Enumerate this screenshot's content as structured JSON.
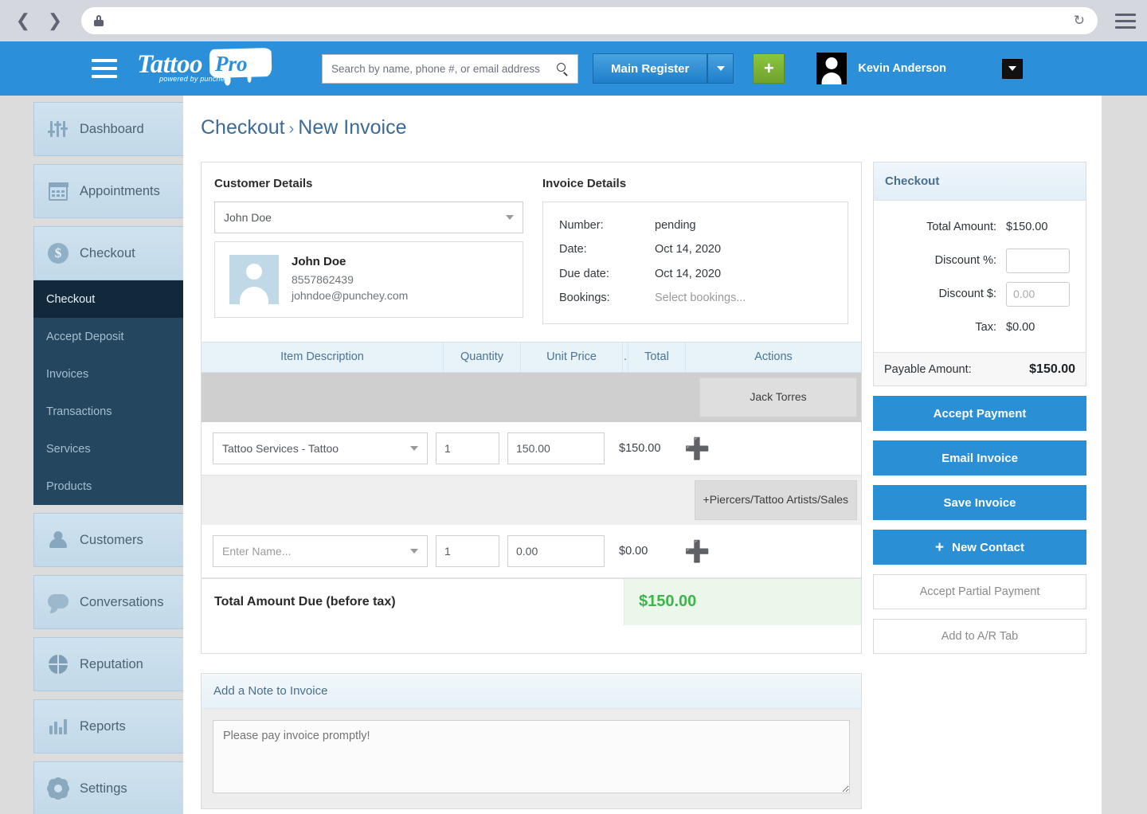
{
  "browser": {
    "back_icon": "back-arrow-icon",
    "forward_icon": "forward-arrow-icon",
    "url_value": "",
    "lock_icon": "lock-icon",
    "reload_icon": "reload-icon",
    "menu_icon": "browser-menu-icon"
  },
  "appbar": {
    "menu_icon": "hamburger-menu-icon",
    "logo": {
      "word1": "Tattoo",
      "word2": "Pro",
      "tagline": "powered by punchey"
    },
    "search": {
      "placeholder": "Search by name, phone #, or email address",
      "value": "",
      "icon": "search-icon"
    },
    "register_label": "Main Register",
    "register_caret_icon": "chevron-down-icon",
    "add_label": "+",
    "user_name": "Kevin Anderson",
    "user_caret_icon": "chevron-down-icon"
  },
  "sidebar": {
    "items": [
      {
        "label": "Dashboard",
        "icon": "sliders-icon"
      },
      {
        "label": "Appointments",
        "icon": "calendar-icon"
      },
      {
        "label": "Checkout",
        "icon": "dollar-circle-icon"
      }
    ],
    "submenu": [
      {
        "label": "Checkout",
        "active": true
      },
      {
        "label": "Accept Deposit",
        "active": false
      },
      {
        "label": "Invoices",
        "active": false
      },
      {
        "label": "Transactions",
        "active": false
      },
      {
        "label": "Services",
        "active": false
      },
      {
        "label": "Products",
        "active": false
      }
    ],
    "items_after": [
      {
        "label": "Customers",
        "icon": "person-icon"
      },
      {
        "label": "Conversations",
        "icon": "chat-bubble-icon"
      },
      {
        "label": "Reputation",
        "icon": "globe-icon"
      },
      {
        "label": "Reports",
        "icon": "bar-chart-icon"
      },
      {
        "label": "Settings",
        "icon": "gear-icon"
      }
    ]
  },
  "breadcrumb": {
    "parent": "Checkout",
    "separator": "›",
    "current": "New Invoice"
  },
  "customer": {
    "section_title": "Customer Details",
    "select_value": "John Doe",
    "name": "John Doe",
    "phone": "8557862439",
    "email": "johndoe@punchey.com"
  },
  "invoice": {
    "section_title": "Invoice Details",
    "rows": [
      {
        "key": "Number:",
        "value": "pending",
        "muted": false
      },
      {
        "key": "Date:",
        "value": "Oct 14, 2020",
        "muted": false
      },
      {
        "key": "Due date:",
        "value": "Oct 14, 2020",
        "muted": false
      },
      {
        "key": "Bookings:",
        "value": "Select bookings...",
        "muted": true
      }
    ]
  },
  "items_table": {
    "headers": {
      "description": "Item Description",
      "quantity": "Quantity",
      "unit_price": "Unit Price",
      "dot": ".",
      "total": "Total",
      "actions": "Actions"
    },
    "groups": [
      {
        "chip_label": "Jack Torres",
        "row": {
          "description": "Tattoo Services - Tattoo",
          "quantity": "1",
          "unit_price": "150.00",
          "total": "$150.00",
          "add_icon": "add-plus-icon"
        }
      },
      {
        "chip_label": "+Piercers/Tattoo Artists/Sales",
        "row": {
          "description": "",
          "description_placeholder": "Enter Name...",
          "quantity": "1",
          "unit_price": "0.00",
          "total": "$0.00",
          "add_icon": "add-plus-icon"
        }
      }
    ],
    "total_label": "Total Amount Due (before tax)",
    "total_value": "$150.00"
  },
  "note": {
    "header": "Add a Note to Invoice",
    "value": "",
    "placeholder": "Please pay invoice promptly!"
  },
  "checkout_panel": {
    "title": "Checkout",
    "total_amount_label": "Total Amount:",
    "total_amount_value": "$150.00",
    "discount_pct_label": "Discount %:",
    "discount_pct_value": "",
    "discount_pct_placeholder": "",
    "discount_amt_label": "Discount $:",
    "discount_amt_value": "",
    "discount_amt_placeholder": "0.00",
    "tax_label": "Tax:",
    "tax_value": "$0.00",
    "payable_label": "Payable Amount:",
    "payable_value": "$150.00",
    "buttons": [
      {
        "label": "Accept Payment",
        "style": "primary",
        "icon": ""
      },
      {
        "label": "Email Invoice",
        "style": "primary",
        "icon": ""
      },
      {
        "label": "Save Invoice",
        "style": "primary",
        "icon": ""
      },
      {
        "label": "New Contact",
        "style": "primary",
        "icon": "+"
      },
      {
        "label": "Accept Partial Payment",
        "style": "ghost",
        "icon": ""
      },
      {
        "label": "Add to A/R Tab",
        "style": "ghost",
        "icon": ""
      }
    ]
  },
  "colors": {
    "brand_blue": "#2b90d9",
    "green": "#3cb54a",
    "sidebar_dark": "#24465e",
    "sidebar_item": "#c5dcea"
  }
}
